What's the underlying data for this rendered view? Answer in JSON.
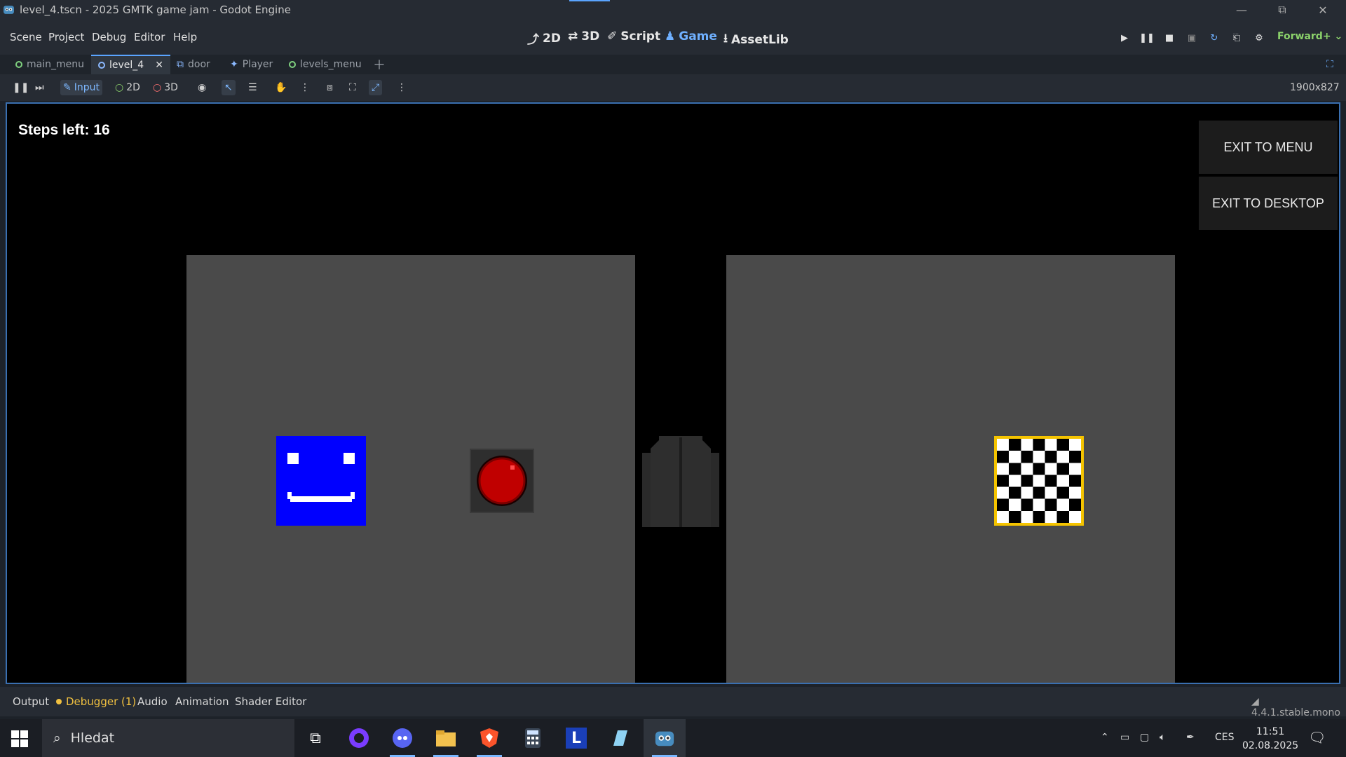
{
  "window": {
    "title": "level_4.tscn - 2025 GMTK game jam - Godot Engine",
    "controls": [
      "minimize",
      "restore",
      "close"
    ]
  },
  "menubar": {
    "items": [
      "Scene",
      "Project",
      "Debug",
      "Editor",
      "Help"
    ],
    "workspaces": [
      {
        "label": "2D",
        "icon": "2d-icon",
        "active": false
      },
      {
        "label": "3D",
        "icon": "3d-icon",
        "active": false
      },
      {
        "label": "Script",
        "icon": "script-icon",
        "active": false
      },
      {
        "label": "Game",
        "icon": "game-icon",
        "active": true
      },
      {
        "label": "AssetLib",
        "icon": "assetlib-icon",
        "active": false
      }
    ],
    "run_controls": [
      "play",
      "pause",
      "stop",
      "remote-debug",
      "reload",
      "movie-maker",
      "debug-options"
    ],
    "renderer": "Forward+"
  },
  "scene_tabs": [
    {
      "label": "main_menu",
      "icon": "scene-icon",
      "active": false
    },
    {
      "label": "level_4",
      "icon": "scene-icon",
      "active": true
    },
    {
      "label": "door",
      "icon": "door-icon",
      "active": false
    },
    {
      "label": "Player",
      "icon": "player-icon",
      "active": false
    },
    {
      "label": "levels_menu",
      "icon": "scene-icon",
      "active": false
    }
  ],
  "game_toolbar": {
    "input_label": "Input",
    "mode_2d": "2D",
    "mode_3d": "3D",
    "resolution": "1900x827"
  },
  "game": {
    "steps_text": "Steps left: 16",
    "buttons": {
      "exit_menu": "EXIT TO MENU",
      "exit_desktop": "EXIT TO DESKTOP"
    },
    "colors": {
      "player": "#0000ff",
      "button": "#c00000",
      "goal_border": "#f5c400",
      "room": "#4a4a4a"
    }
  },
  "bottom_panel": {
    "tabs": [
      "Output",
      "Debugger (1)",
      "Audio",
      "Animation",
      "Shader Editor"
    ],
    "version": "4.4.1.stable.mono"
  },
  "taskbar": {
    "search_placeholder": "Hledat",
    "language": "CES",
    "time": "11:51",
    "date": "02.08.2025"
  }
}
